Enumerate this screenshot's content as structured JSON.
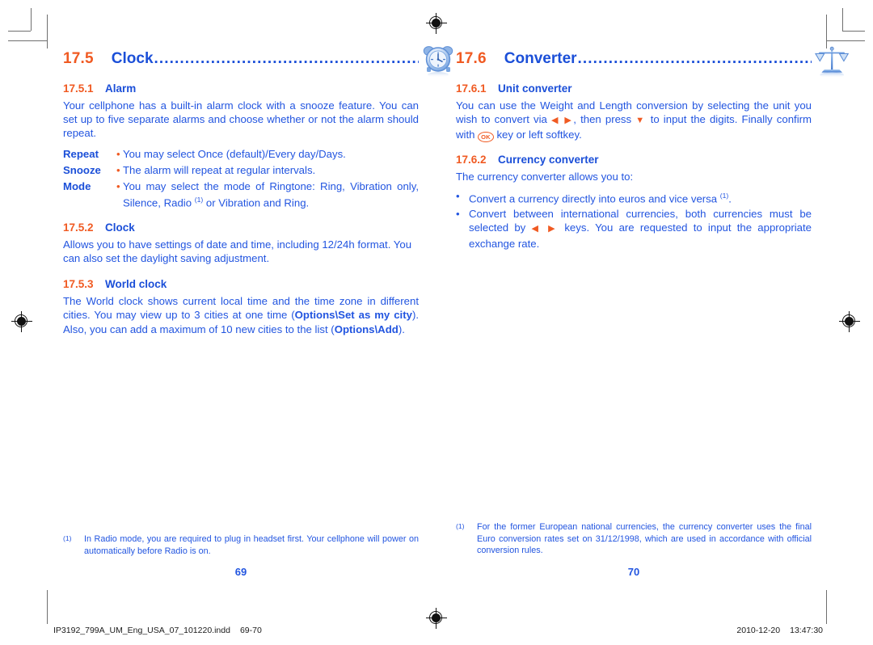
{
  "document": {
    "left_page_number": "69",
    "right_page_number": "70",
    "print_file": "IP3192_799A_UM_Eng_USA_07_101220.indd",
    "print_pages": "69-70",
    "print_date": "2010-12-20",
    "print_time": "13:47:30"
  },
  "colors": {
    "orange": "#F05A22",
    "blue_heading": "#1B4FD8",
    "blue_body": "#2255E0"
  },
  "left_column": {
    "section": {
      "number": "17.5",
      "title": "Clock",
      "dots": "..................................................................",
      "icon": "alarm-clock-icon"
    },
    "sub1": {
      "number": "17.5.1",
      "title": "Alarm",
      "paragraph": "Your cellphone has a built-in alarm clock with a snooze feature. You can set up to five separate alarms and choose whether or not the alarm should repeat."
    },
    "definitions": [
      {
        "term": "Repeat",
        "bullet": "•",
        "text": "You may select Once (default)/Every day/Days."
      },
      {
        "term": "Snooze",
        "bullet": "•",
        "text": "The alarm will repeat at regular intervals."
      },
      {
        "term": "Mode",
        "bullet": "•",
        "text_part1": "You may select the mode of Ringtone: Ring, Vibration only, Silence, Radio ",
        "footnote_mark": "(1)",
        "text_part2": " or Vibration and Ring."
      }
    ],
    "sub2": {
      "number": "17.5.2",
      "title": "Clock",
      "paragraph": "Allows you to have settings of date and time, including 12/24h format. You can also set the daylight saving adjustment."
    },
    "sub3": {
      "number": "17.5.3",
      "title": "World clock",
      "para_a": "The World clock shows current local time and the time zone in different cities. You may view up to 3 cities at one time (",
      "para_a_bold": "Options\\Set as my city",
      "para_b": "). Also, you can add a maximum of 10 new cities to the list (",
      "para_b_bold": "Options\\Add",
      "para_c": ")."
    },
    "footnote": {
      "mark": "(1)",
      "text": "In Radio mode, you are required to plug in headset first. Your cellphone will power on automatically before Radio is on."
    }
  },
  "right_column": {
    "section": {
      "number": "17.6",
      "title": "Converter",
      "dots": "..........................................................",
      "icon": "balance-scales-icon"
    },
    "sub1": {
      "number": "17.6.1",
      "title": "Unit converter",
      "para_a": "You can use the Weight and Length conversion by selecting the unit you wish to convert via ",
      "arrows_lr": "◀ ▶",
      "para_b": ", then press ",
      "arrow_down": "▼",
      "para_c": " to input the digits. Finally confirm with ",
      "ok_key": "OK",
      "para_d": " key or left softkey."
    },
    "sub2": {
      "number": "17.6.2",
      "title": "Currency converter",
      "intro": "The currency converter allows you to:",
      "bullets": [
        {
          "mark": "•",
          "text_part1": "Convert a currency directly into euros and vice versa ",
          "footnote_mark": "(1)",
          "text_part2": "."
        },
        {
          "mark": "•",
          "text_part1": "Convert between international currencies, both currencies must be selected by ",
          "arrows_lr": "◀ ▶",
          "text_part2": " keys. You are requested to input the appropriate exchange rate."
        }
      ]
    },
    "footnote": {
      "mark": "(1)",
      "text": "For the former European national currencies, the currency converter uses the final Euro conversion rates set on 31/12/1998, which are used in accordance with official conversion rules."
    }
  }
}
